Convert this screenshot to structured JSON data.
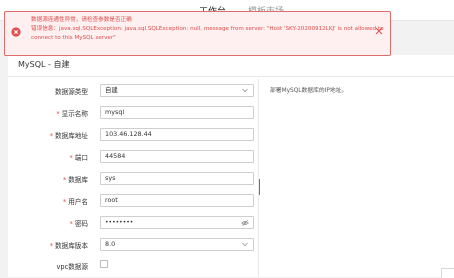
{
  "nav": {
    "tabs": [
      {
        "label": "工作台"
      },
      {
        "label": "模板市场"
      }
    ]
  },
  "alert": {
    "line1": "数据源连通性异常，请检查参数是否正确",
    "line2": "错误信息：java.sql.SQLException: java.sql.SQLException: null, message from server: \"Host 'SKY-20200912LKJ' is not allowed to",
    "line3": "connect to this MySQL server\""
  },
  "panel": {
    "title": "MySQL - 自建",
    "hint": "部署MySQL数据库的IP地址。"
  },
  "form": {
    "source_type": {
      "label": "数据源类型",
      "value": "自建"
    },
    "display_name": {
      "label": "显示名称",
      "value": "mysql"
    },
    "db_address": {
      "label": "数据库地址",
      "value": "103.46.128.44"
    },
    "port": {
      "label": "端口",
      "value": "44584"
    },
    "database": {
      "label": "数据库",
      "value": "sys"
    },
    "username": {
      "label": "用户名",
      "value": "root"
    },
    "password": {
      "label": "密码",
      "value": "••••••••"
    },
    "db_version": {
      "label": "数据库版本",
      "value": "8.0"
    },
    "vpc": {
      "label": "vpc数据源"
    }
  },
  "colors": {
    "error": "#e04b4b",
    "accent": "#4a78c5"
  }
}
